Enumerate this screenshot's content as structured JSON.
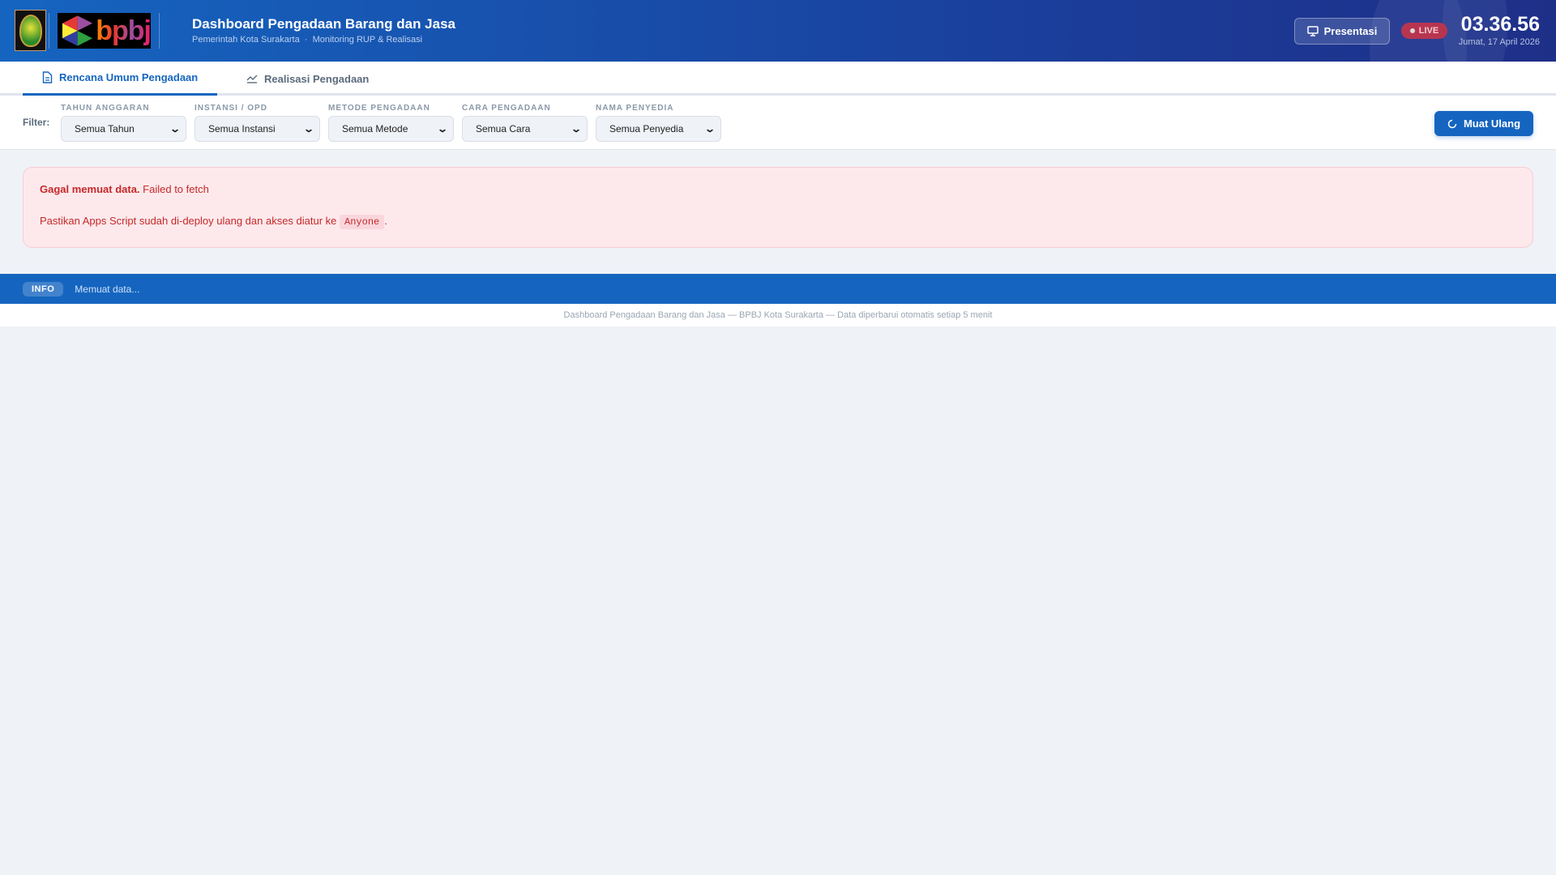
{
  "header": {
    "title": "Dashboard Pengadaan Barang dan Jasa",
    "subtitle": "Pemerintah Kota Surakarta  ·  Monitoring RUP & Realisasi",
    "logo_text": "bpbj",
    "presentation_label": "Presentasi",
    "live_label": "LIVE",
    "clock": "03.36.56",
    "date": "Jumat, 17 April 2026"
  },
  "tabs": [
    {
      "label": "Rencana Umum Pengadaan",
      "icon": "document-icon",
      "active": true
    },
    {
      "label": "Realisasi Pengadaan",
      "icon": "chart-line-icon",
      "active": false
    }
  ],
  "filter": {
    "label": "Filter:",
    "groups": [
      {
        "label": "TAHUN ANGGARAN",
        "value": "Semua Tahun"
      },
      {
        "label": "INSTANSI / OPD",
        "value": "Semua Instansi"
      },
      {
        "label": "METODE PENGADAAN",
        "value": "Semua Metode"
      },
      {
        "label": "CARA PENGADAAN",
        "value": "Semua Cara"
      },
      {
        "label": "NAMA PENYEDIA",
        "value": "Semua Penyedia"
      }
    ],
    "reload_label": "Muat Ulang"
  },
  "error": {
    "title": "Gagal memuat data.",
    "message": "Failed to fetch",
    "hint": "Pastikan Apps Script sudah di-deploy ulang dan akses diatur ke",
    "code": "Anyone",
    "hint_end": "."
  },
  "status": {
    "badge": "INFO",
    "text": "Memuat data..."
  },
  "footer": {
    "text": "Dashboard Pengadaan Barang dan Jasa — BPBJ Kota Surakarta — Data diperbarui otomatis setiap 5 menit"
  },
  "colors": {
    "primary": "#1565c0",
    "error_text": "#c62828",
    "error_bg": "#fde9ec",
    "live": "#b83550"
  }
}
